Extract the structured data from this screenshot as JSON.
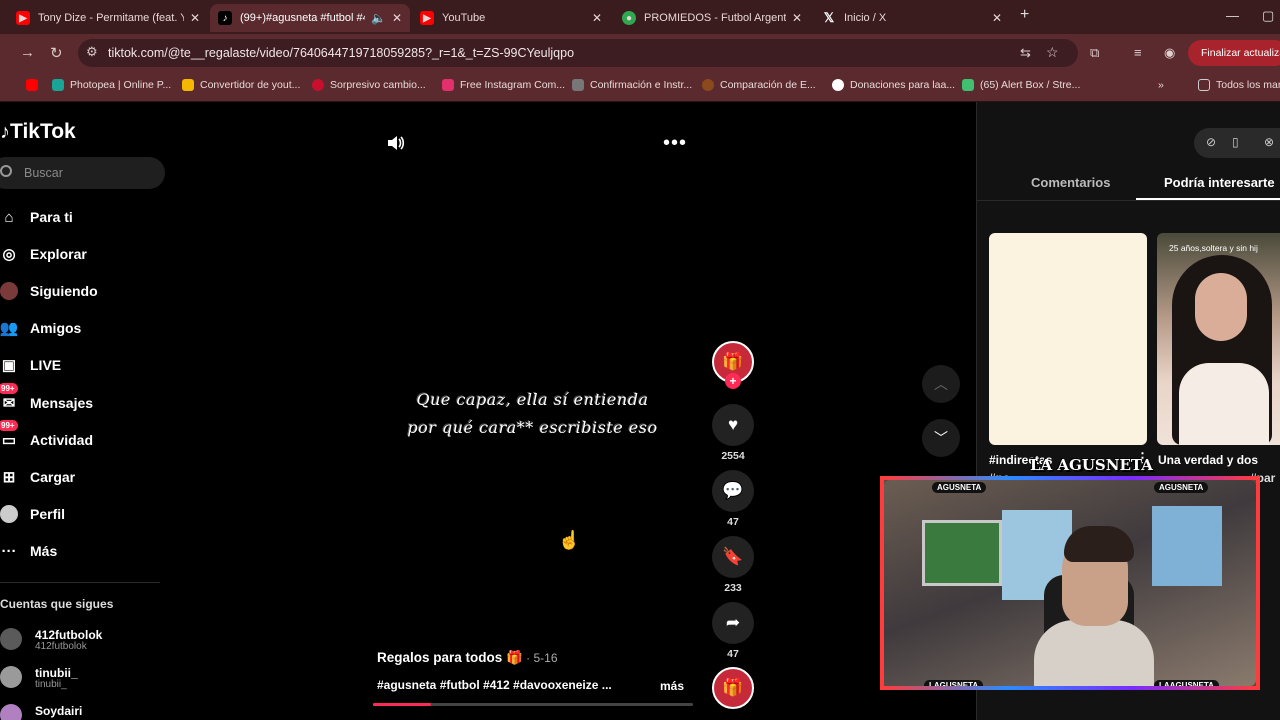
{
  "browser": {
    "tabs": [
      {
        "title": "Tony Dize - Permitame (feat. Ya",
        "icon": "youtube-icon",
        "color": "#ff0000"
      },
      {
        "title": "(99+)#agusneta #futbol #4",
        "icon": "tiktok-icon",
        "color": "#000000"
      },
      {
        "title": "YouTube",
        "icon": "youtube-icon",
        "color": "#ff0000"
      },
      {
        "title": "PROMIEDOS - Futbol Argentin",
        "icon": "promiedos-icon",
        "color": "#2fa84f"
      },
      {
        "title": "Inicio / X",
        "icon": "x-icon",
        "color": "#000000"
      }
    ],
    "url": "tiktok.com/@te__regalaste/video/7640644719718059285?_r=1&_t=ZS-99CYeuljqpo",
    "update_button": "Finalizar actualiza",
    "bookmarks": [
      {
        "label": "Photopea | Online P...",
        "color": "#18a497"
      },
      {
        "label": "Convertidor de yout...",
        "color": "#f5b800"
      },
      {
        "label": "Sorpresivo cambio...",
        "color": "#c8102e"
      },
      {
        "label": "Free Instagram Com...",
        "color": "#e1306c"
      },
      {
        "label": "Confirmación e Instr...",
        "color": "#777777"
      },
      {
        "label": "Comparación de E...",
        "color": "#8b4a1c"
      },
      {
        "label": "Donaciones para laa...",
        "color": "#ffffff"
      },
      {
        "label": "(65) Alert Box / Stre...",
        "color": "#3fbf6f"
      },
      {
        "label": "Todos los mar",
        "color": "#cccccc"
      }
    ]
  },
  "tiktok": {
    "logo": "TikTok",
    "search_placeholder": "Buscar",
    "nav": [
      {
        "label": "Para ti",
        "icon": "home-icon"
      },
      {
        "label": "Explorar",
        "icon": "compass-icon"
      },
      {
        "label": "Siguiendo",
        "icon": "following-avatar-icon"
      },
      {
        "label": "Amigos",
        "icon": "friends-icon"
      },
      {
        "label": "LIVE",
        "icon": "live-icon"
      },
      {
        "label": "Mensajes",
        "icon": "messages-icon",
        "badge": "99+"
      },
      {
        "label": "Actividad",
        "icon": "activity-icon",
        "badge": "99+"
      },
      {
        "label": "Cargar",
        "icon": "upload-icon"
      },
      {
        "label": "Perfil",
        "icon": "profile-icon"
      },
      {
        "label": "Más",
        "icon": "more-icon"
      }
    ],
    "following_title": "Cuentas que sigues",
    "following": [
      {
        "name": "412futbolok",
        "handle": "412futbolok"
      },
      {
        "name": "tinubii_",
        "handle": "tinubii_"
      },
      {
        "name": "Soydairi",
        "handle": ""
      }
    ],
    "video": {
      "caption_line1": "Que capaz, ella sí entienda",
      "caption_line2": "por qué cara** escribiste eso",
      "title": "Regalos para todos 🎁",
      "date": " · 5-16",
      "tags": "#agusneta #futbol #412  #davooxeneize ...",
      "more": "más",
      "progress": 0.18
    },
    "actions": {
      "likes": "2554",
      "comments": "47",
      "saves": "233",
      "shares": "47"
    },
    "right_panel": {
      "tab_comments": "Comentarios",
      "tab_interest": "Podría interesarte",
      "card1_title": "#indirectas",
      "card1_sub": "#pa",
      "card2_overlay": "25 años,soltera y sin hij",
      "card2_title": "Una verdad y dos",
      "card2_sub": "#par"
    }
  },
  "stream_overlay": {
    "logo": "LA AGUSNETA",
    "label_top_left": "AGUSNETA",
    "label_top_right": "AGUSNETA",
    "label_bottom_left": "LAGUSNETA",
    "label_bottom_right": "LAAGUSNETA"
  }
}
